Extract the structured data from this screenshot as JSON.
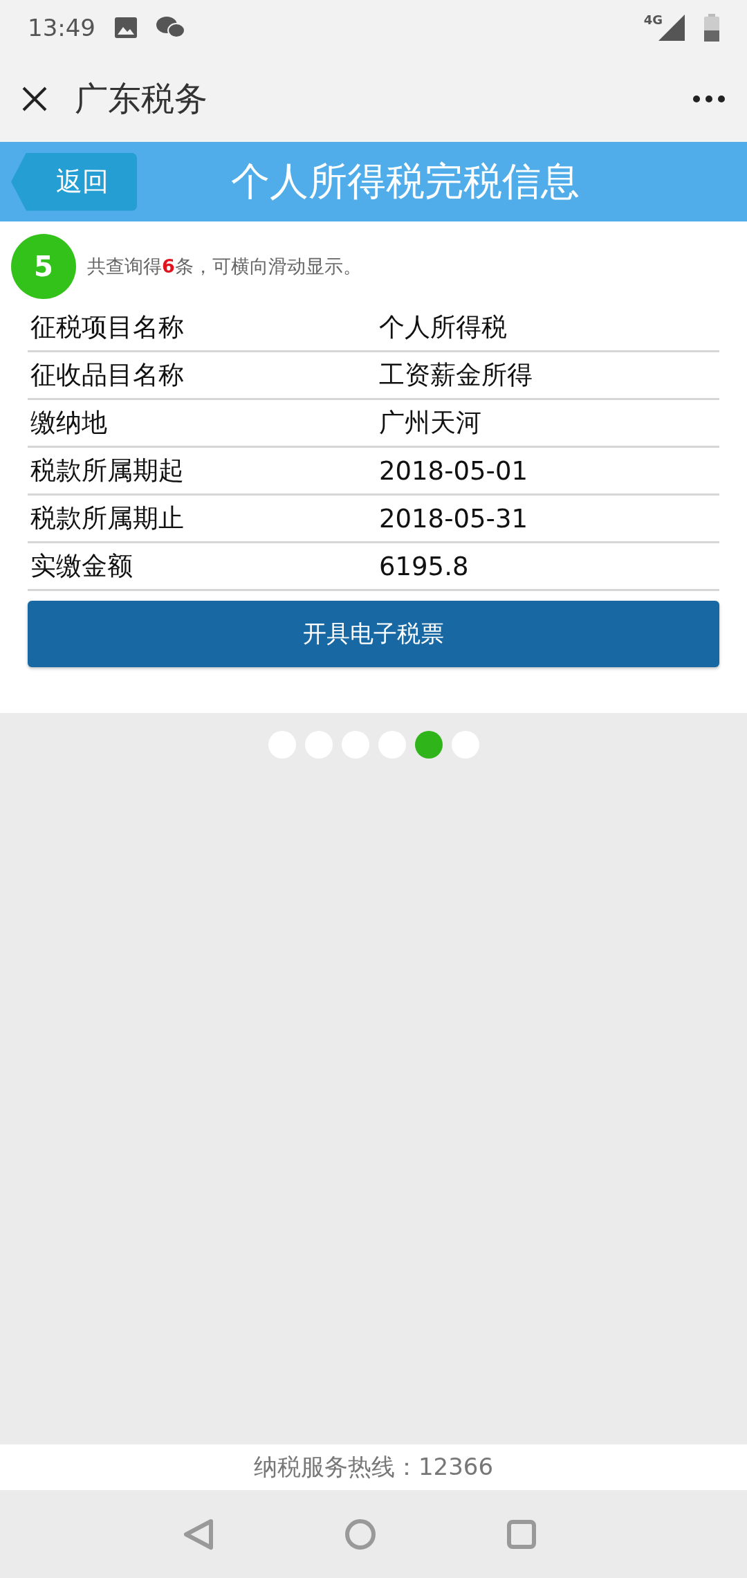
{
  "status_bar": {
    "time": "13:49",
    "network": "4G"
  },
  "header": {
    "title": "广东税务"
  },
  "banner": {
    "back": "返回",
    "title": "个人所得税完税信息"
  },
  "summary": {
    "index": "5",
    "text": "共查询得**6**条，可横向滑动显示。"
  },
  "table": {
    "rows": [
      {
        "label": "征税项目名称",
        "value": "个人所得税"
      },
      {
        "label": "征收品目名称",
        "value": "工资薪金所得"
      },
      {
        "label": "缴纳地",
        "value": "广州天河"
      },
      {
        "label": "税款所属期起",
        "value": "2018-05-01"
      },
      {
        "label": "税款所属期止",
        "value": "2018-05-31"
      },
      {
        "label": "实缴金额",
        "value": "6195.8"
      }
    ]
  },
  "action_button": "开具电子税票",
  "pager": [
    {
      "selected": false
    },
    {
      "selected": false
    },
    {
      "selected": false
    },
    {
      "selected": false
    },
    {
      "selected": true
    },
    {
      "selected": false
    }
  ],
  "footer": "纳税服务热线：12366"
}
